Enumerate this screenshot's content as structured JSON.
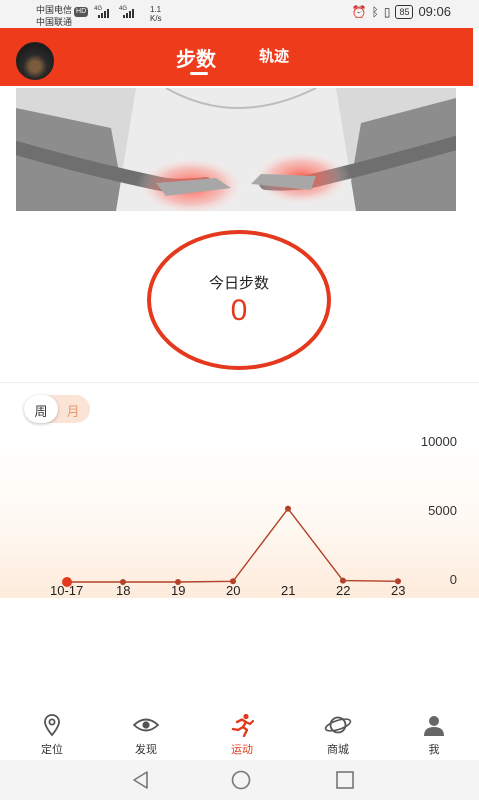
{
  "status_bar": {
    "carrier1": "中国电信",
    "carrier1_badge": "HD",
    "carrier2": "中国联通",
    "net_label1": "4G",
    "net_label2": "4G",
    "net_speed_value": "1.1",
    "net_speed_unit": "K/s",
    "battery": "85",
    "time": "09:06"
  },
  "header": {
    "tabs": [
      {
        "label": "步数",
        "active": true
      },
      {
        "label": "轨迹",
        "active": false
      }
    ],
    "color": "#ed3b1c"
  },
  "today": {
    "label": "今日步数",
    "value": "0",
    "accent": "#e4391c"
  },
  "period_toggle": {
    "week_label": "周",
    "month_label": "月",
    "selected": "week"
  },
  "chart_data": {
    "type": "line",
    "categories": [
      "10-17",
      "18",
      "19",
      "20",
      "21",
      "22",
      "23"
    ],
    "series": [
      {
        "values": [
          0,
          0,
          0,
          50,
          5200,
          100,
          50
        ],
        "color": "#b3402a"
      }
    ],
    "y_ticks": [
      "10000",
      "5000",
      "0"
    ],
    "ylim": [
      0,
      10000
    ],
    "grid": false
  },
  "bottom_nav": [
    {
      "label": "定位",
      "icon": "location-pin-icon",
      "active": false
    },
    {
      "label": "发现",
      "icon": "eye-icon",
      "active": false
    },
    {
      "label": "运动",
      "icon": "running-icon",
      "active": true
    },
    {
      "label": "商城",
      "icon": "planet-icon",
      "active": false
    },
    {
      "label": "我",
      "icon": "person-icon",
      "active": false
    }
  ]
}
